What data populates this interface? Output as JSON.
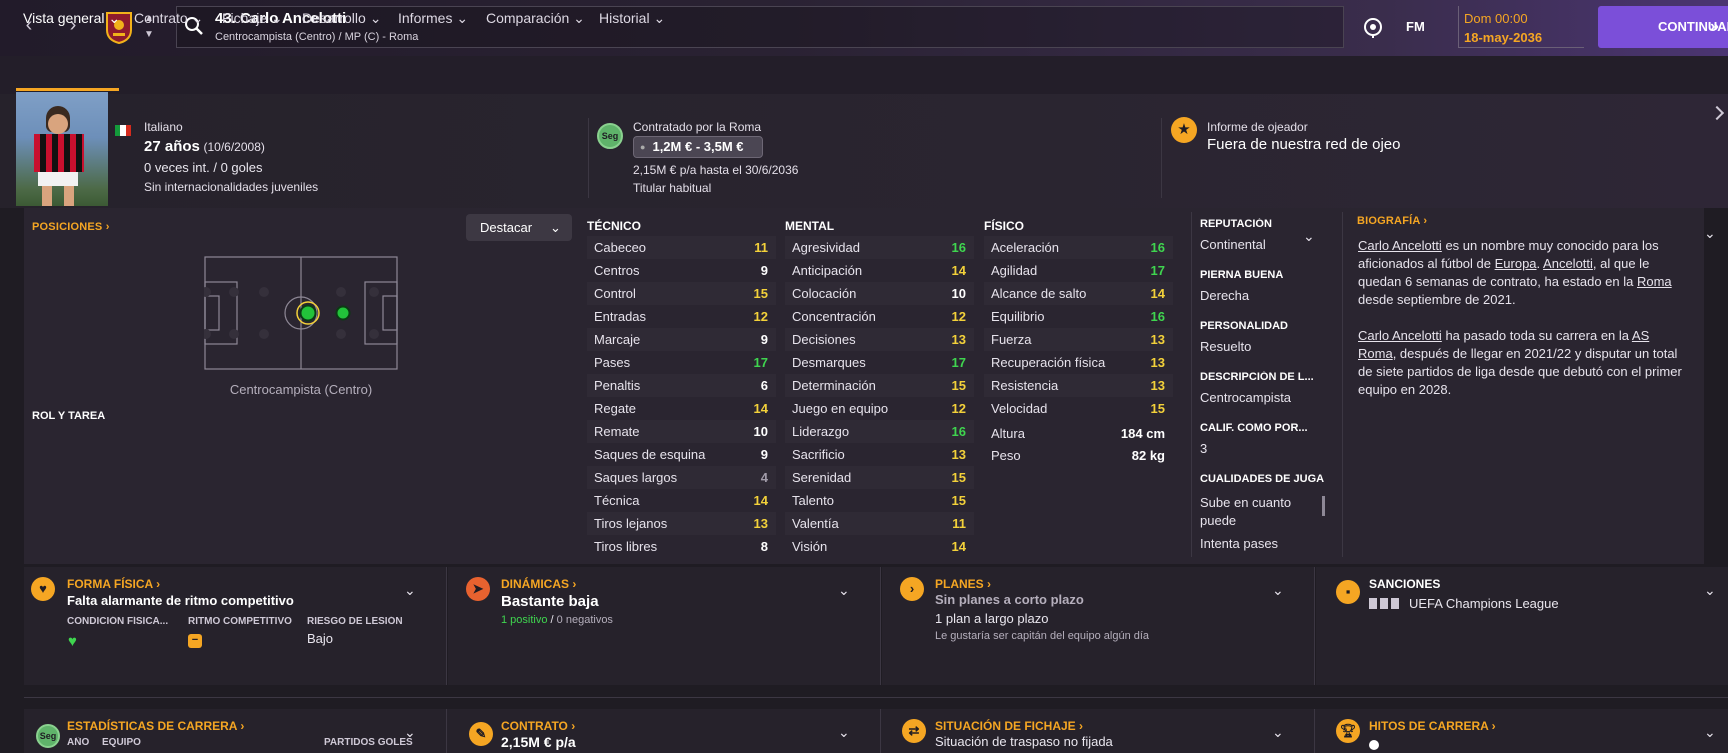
{
  "topbar": {
    "back_icon": "chevron-left-icon",
    "forward_icon": "chevron-right-icon",
    "player_title": "43. Carlo Ancelotti",
    "player_subtitle": "Centrocampista (Centro) / MP (C) - Roma",
    "fm_label": "FM",
    "date_day": "Dom 00:00",
    "date_full": "18-may-2036",
    "continue_label": "CONTINUAR"
  },
  "tabs": [
    "Vista general",
    "Contrato",
    "Fichaje",
    "Desarrollo",
    "Informes",
    "Comparación",
    "Historial"
  ],
  "header": {
    "nationality": "Italiano",
    "age": "27 años",
    "birth": "(10/6/2008)",
    "caps": "0 veces int. / 0 goles",
    "youth_caps": "Sin internacionalidades juveniles",
    "contract_badge": "Seg",
    "contract_title": "Contratado por la Roma",
    "value_range": "1,2M € - 3,5M €",
    "wage": "2,15M € p/a hasta el 30/6/2036",
    "status": "Titular habitual",
    "scout_title": "Informe de ojeador",
    "scout_value": "Fuera de nuestra red de ojeo"
  },
  "positions": {
    "title": "POSICIONES",
    "highlight_button": "Destacar",
    "position_caption": "Centrocampista (Centro)",
    "role_title": "ROL Y TAREA"
  },
  "attributes": {
    "tecnico_title": "TÉCNICO",
    "mental_title": "MENTAL",
    "fisico_title": "FÍSICO",
    "tecnico": [
      {
        "name": "Cabeceo",
        "value": "11",
        "c": "y"
      },
      {
        "name": "Centros",
        "value": "9",
        "c": "w"
      },
      {
        "name": "Control",
        "value": "15",
        "c": "y"
      },
      {
        "name": "Entradas",
        "value": "12",
        "c": "y"
      },
      {
        "name": "Marcaje",
        "value": "9",
        "c": "w"
      },
      {
        "name": "Pases",
        "value": "17",
        "c": "g"
      },
      {
        "name": "Penaltis",
        "value": "6",
        "c": "w"
      },
      {
        "name": "Regate",
        "value": "14",
        "c": "y"
      },
      {
        "name": "Remate",
        "value": "10",
        "c": "w"
      },
      {
        "name": "Saques de esquina",
        "value": "9",
        "c": "w"
      },
      {
        "name": "Saques largos",
        "value": "4",
        "c": "d"
      },
      {
        "name": "Técnica",
        "value": "14",
        "c": "y"
      },
      {
        "name": "Tiros lejanos",
        "value": "13",
        "c": "y"
      },
      {
        "name": "Tiros libres",
        "value": "8",
        "c": "w"
      }
    ],
    "mental": [
      {
        "name": "Agresividad",
        "value": "16",
        "c": "g"
      },
      {
        "name": "Anticipación",
        "value": "14",
        "c": "y"
      },
      {
        "name": "Colocación",
        "value": "10",
        "c": "w"
      },
      {
        "name": "Concentración",
        "value": "12",
        "c": "y"
      },
      {
        "name": "Decisiones",
        "value": "13",
        "c": "y"
      },
      {
        "name": "Desmarques",
        "value": "17",
        "c": "g"
      },
      {
        "name": "Determinación",
        "value": "15",
        "c": "y"
      },
      {
        "name": "Juego en equipo",
        "value": "12",
        "c": "y"
      },
      {
        "name": "Liderazgo",
        "value": "16",
        "c": "g"
      },
      {
        "name": "Sacrificio",
        "value": "13",
        "c": "y"
      },
      {
        "name": "Serenidad",
        "value": "15",
        "c": "y"
      },
      {
        "name": "Talento",
        "value": "15",
        "c": "y"
      },
      {
        "name": "Valentía",
        "value": "11",
        "c": "y"
      },
      {
        "name": "Visión",
        "value": "14",
        "c": "y"
      }
    ],
    "fisico": [
      {
        "name": "Aceleración",
        "value": "16",
        "c": "g"
      },
      {
        "name": "Agilidad",
        "value": "17",
        "c": "g"
      },
      {
        "name": "Alcance de salto",
        "value": "14",
        "c": "y"
      },
      {
        "name": "Equilibrio",
        "value": "16",
        "c": "g"
      },
      {
        "name": "Fuerza",
        "value": "13",
        "c": "y"
      },
      {
        "name": "Recuperación física",
        "value": "13",
        "c": "y"
      },
      {
        "name": "Resistencia",
        "value": "13",
        "c": "y"
      },
      {
        "name": "Velocidad",
        "value": "15",
        "c": "y"
      }
    ],
    "height_label": "Altura",
    "height_value": "184 cm",
    "weight_label": "Peso",
    "weight_value": "82 kg"
  },
  "info": {
    "reputation_label": "REPUTACIÓN",
    "reputation_value": "Continental",
    "foot_label": "PIERNA BUENA",
    "foot_value": "Derecha",
    "personality_label": "PERSONALIDAD",
    "personality_value": "Resuelto",
    "description_label": "DESCRIPCIÓN DE L...",
    "description_value": "Centrocampista",
    "rating_label": "CALIF. COMO POR...",
    "rating_value": "3",
    "qualities_label": "CUALIDADES DE JUGA",
    "qualities_1": "Sube en cuanto puede",
    "qualities_2": "Intenta pases"
  },
  "bio": {
    "title": "BIOGRAFÍA",
    "p1_a": "Carlo Ancelotti",
    "p1_b": " es un nombre muy conocido para los aficionados al fútbol de ",
    "p1_c": "Europa",
    "p1_d": ". ",
    "p1_e": "Ancelotti",
    "p1_f": ", al que le quedan 6 semanas de contrato, ha estado en la ",
    "p1_g": "Roma",
    "p1_h": " desde septiembre de 2021.",
    "p2_a": "Carlo Ancelotti",
    "p2_b": " ha pasado toda su carrera en la ",
    "p2_c": "AS Roma",
    "p2_d": ", después de llegar en 2021/22 y disputar un total de siete partidos de liga desde que debutó con el primer equipo en 2028."
  },
  "cards": {
    "fitness_title": "FORMA FÍSICA",
    "fitness_value": "Falta alarmante de ritmo competitivo",
    "fitness_cond_label": "CONDICIÓN FÍSICA...",
    "fitness_rhythm_label": "RITMO COMPETITIVO",
    "fitness_injury_label": "RIESGO DE LESIÓN",
    "fitness_injury_value": "Bajo",
    "dyn_title": "DINÁMICAS",
    "dyn_value": "Bastante baja",
    "dyn_positive": "1 positivo",
    "dyn_sep": "/",
    "dyn_negative": "0 negativos",
    "plans_title": "PLANES",
    "plans_value": "Sin planes a corto plazo",
    "plans_long": "1 plan a largo plazo",
    "plans_note": "Le gustaría ser capitán del equipo algún día",
    "sanctions_title": "SANCIONES",
    "sanctions_value": "UEFA Champions League",
    "career_title": "ESTADÍSTICAS DE CARRERA",
    "career_badge": "Seg",
    "career_col_year": "AÑO",
    "career_col_team": "EQUIPO",
    "career_col_matches": "PARTIDOS GOLES",
    "contract_title": "CONTRATO",
    "contract_value": "2,15M € p/a",
    "transfer_title": "SITUACIÓN DE FICHAJE",
    "transfer_value": "Situación de traspaso no fijada",
    "milestones_title": "HITOS DE CARRERA"
  },
  "colors": {
    "accent": "#f5a623",
    "continue": "#7b4fd9",
    "good": "#3fd54f",
    "mid": "#f3d13a"
  }
}
